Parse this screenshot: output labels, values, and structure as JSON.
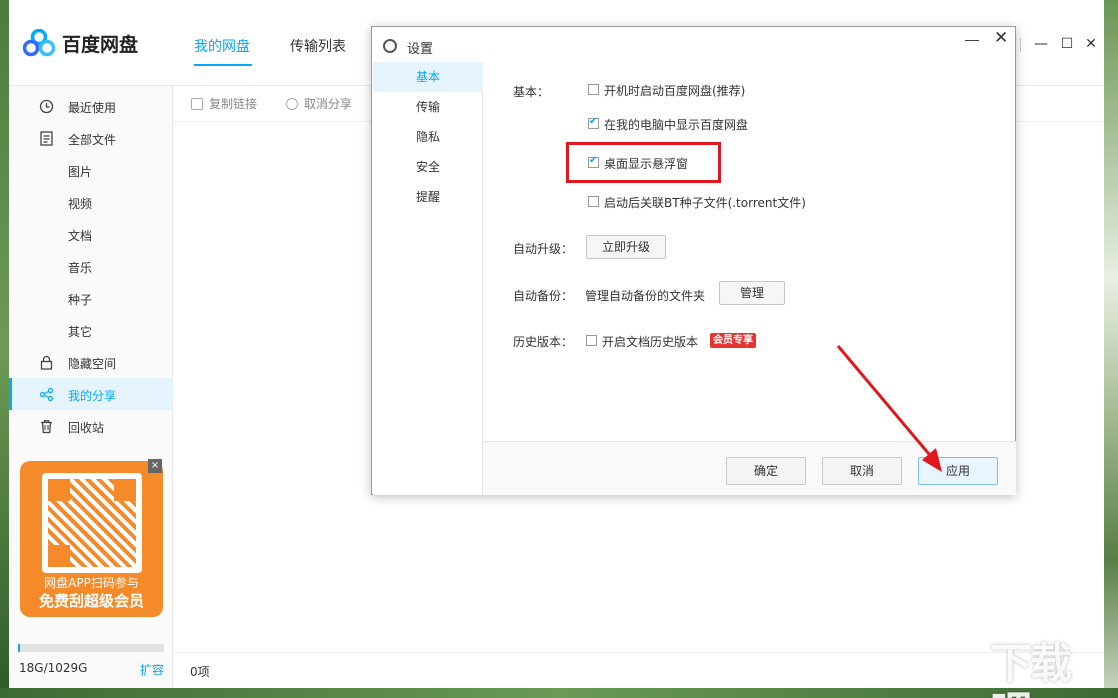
{
  "app": {
    "logo_text": "百度网盘",
    "tabs": [
      {
        "label": "我的网盘",
        "active": true
      },
      {
        "label": "传输列表",
        "active": false
      }
    ]
  },
  "sidebar": {
    "items": [
      {
        "label": "最近使用",
        "icon": "clock-icon"
      },
      {
        "label": "全部文件",
        "icon": "file-icon"
      },
      {
        "label": "图片"
      },
      {
        "label": "视频"
      },
      {
        "label": "文档"
      },
      {
        "label": "音乐"
      },
      {
        "label": "种子"
      },
      {
        "label": "其它"
      },
      {
        "label": "隐藏空间",
        "icon": "lock-icon"
      },
      {
        "label": "我的分享",
        "icon": "share-icon",
        "active": true
      },
      {
        "label": "回收站",
        "icon": "trash-icon"
      }
    ],
    "promo": {
      "line1": "网盘APP扫码参与",
      "line2": "免费刮超级会员",
      "close": "×"
    },
    "quota": {
      "text": "18G/1029G",
      "used_fraction": 0.017,
      "expand_label": "扩容"
    }
  },
  "toolbar": {
    "copy_link": "复制链接",
    "cancel_share": "取消分享"
  },
  "status": {
    "count": "0项"
  },
  "dialog": {
    "title": "设置",
    "nav": [
      {
        "label": "基本",
        "active": true
      },
      {
        "label": "传输"
      },
      {
        "label": "隐私"
      },
      {
        "label": "安全"
      },
      {
        "label": "提醒"
      }
    ],
    "basic": {
      "label": "基本：",
      "options": [
        {
          "label": "开机时启动百度网盘(推荐)",
          "checked": false
        },
        {
          "label": "在我的电脑中显示百度网盘",
          "checked": true
        },
        {
          "label": "桌面显示悬浮窗",
          "checked": true
        },
        {
          "label": "启动后关联BT种子文件(.torrent文件)",
          "checked": false
        }
      ]
    },
    "auto_upgrade": {
      "label": "自动升级：",
      "button": "立即升级"
    },
    "auto_backup": {
      "label": "自动备份：",
      "desc": "管理自动备份的文件夹",
      "button": "管理"
    },
    "history": {
      "label": "历史版本：",
      "option": "开启文档历史版本",
      "checked": false,
      "badge": "会员专享"
    },
    "footer": {
      "ok": "确定",
      "cancel": "取消",
      "apply": "应用"
    }
  },
  "watermark": "下载吧",
  "colors": {
    "accent": "#06a7ff",
    "highlight": "#e0171e",
    "promo": "#f58a2a",
    "badge": "#e8342f"
  }
}
